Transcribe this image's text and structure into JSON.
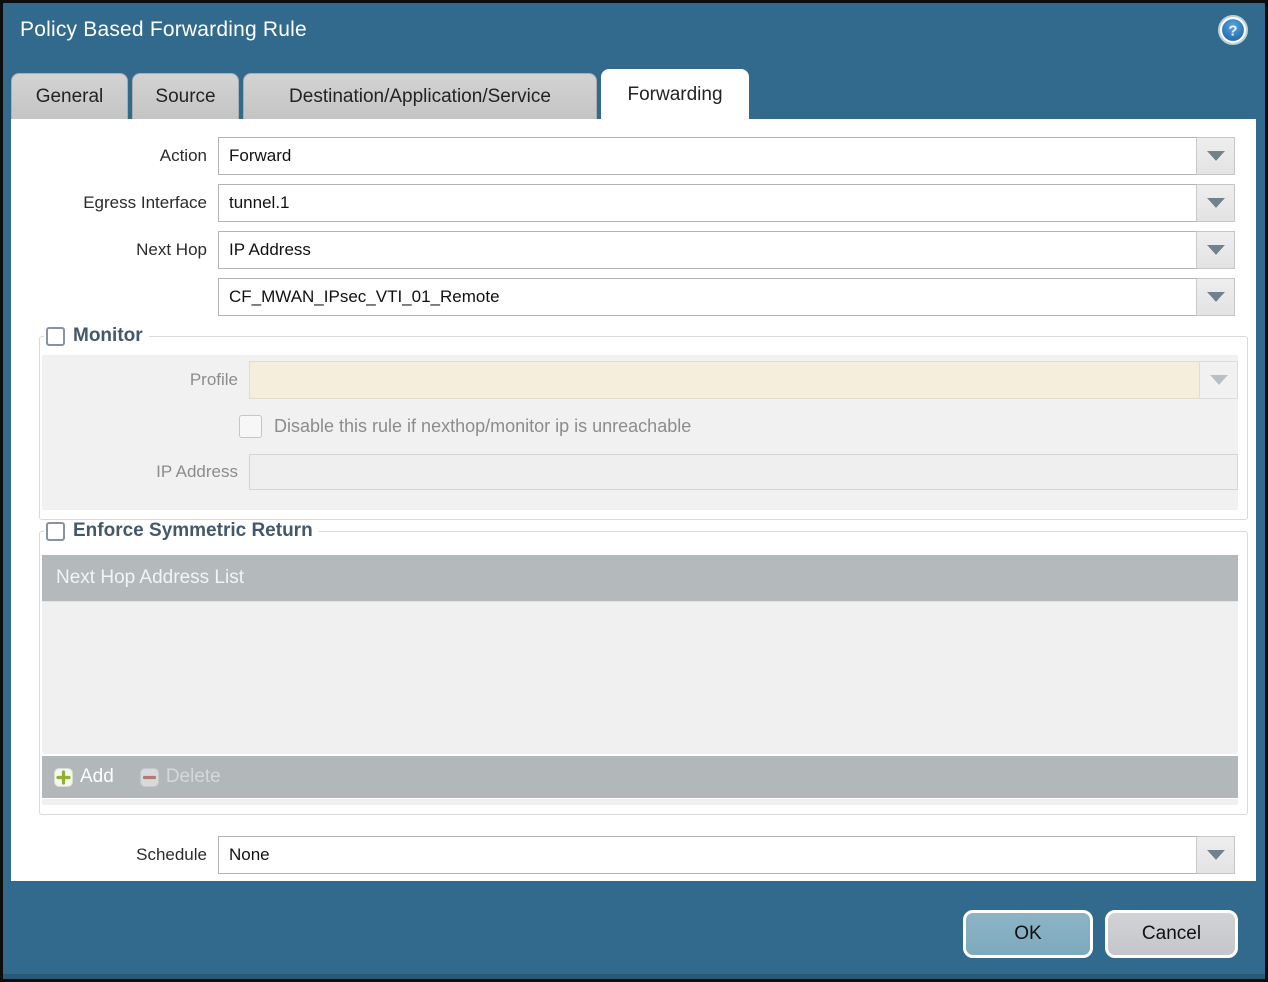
{
  "dialog": {
    "title": "Policy Based Forwarding Rule",
    "help_glyph": "?"
  },
  "tabs": [
    {
      "label": "General",
      "active": false
    },
    {
      "label": "Source",
      "active": false
    },
    {
      "label": "Destination/Application/Service",
      "active": false
    },
    {
      "label": "Forwarding",
      "active": true
    }
  ],
  "form": {
    "action": {
      "label": "Action",
      "value": "Forward"
    },
    "egress_interface": {
      "label": "Egress Interface",
      "value": "tunnel.1"
    },
    "next_hop": {
      "label": "Next Hop",
      "value": "IP Address"
    },
    "next_hop_address": {
      "value": "CF_MWAN_IPsec_VTI_01_Remote"
    },
    "schedule": {
      "label": "Schedule",
      "value": "None"
    }
  },
  "monitor": {
    "label": "Monitor",
    "checked": false,
    "profile_label": "Profile",
    "profile_value": "",
    "disable_rule_label": "Disable this rule if nexthop/monitor ip is unreachable",
    "disable_rule_checked": false,
    "ip_address_label": "IP Address",
    "ip_address_value": ""
  },
  "symmetric_return": {
    "label": "Enforce Symmetric Return",
    "checked": false,
    "table_header": "Next Hop Address List",
    "rows": [],
    "add_label": "Add",
    "delete_label": "Delete",
    "delete_enabled": false
  },
  "footer": {
    "ok_label": "OK",
    "cancel_label": "Cancel"
  },
  "colors": {
    "titlebar_teal": "#316a8c",
    "active_tab": "#ffffff",
    "inactive_tab": "#c9c9c9",
    "disabled_field_cream": "#f5eedc",
    "table_gray": "#b4b9bb",
    "table_body": "#f0f0f1",
    "ok_button": "#82abbf",
    "cancel_button": "#c9cbce",
    "add_icon_green": "#93ad37",
    "delete_icon_red": "#b27a70"
  }
}
